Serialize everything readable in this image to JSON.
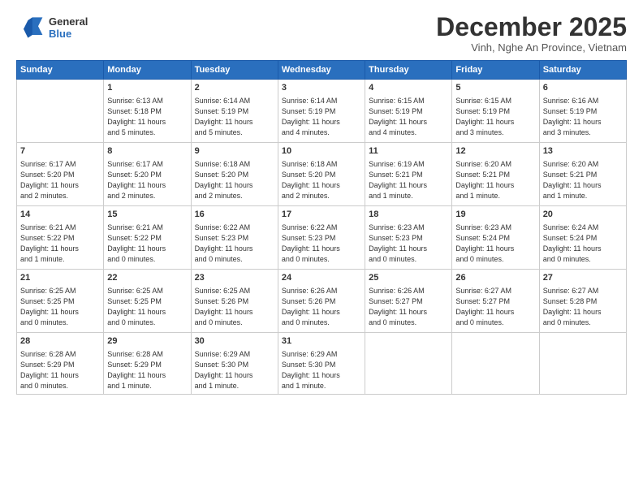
{
  "header": {
    "logo_line1": "General",
    "logo_line2": "Blue",
    "month_title": "December 2025",
    "location": "Vinh, Nghe An Province, Vietnam"
  },
  "days_of_week": [
    "Sunday",
    "Monday",
    "Tuesday",
    "Wednesday",
    "Thursday",
    "Friday",
    "Saturday"
  ],
  "weeks": [
    [
      {
        "date": "",
        "info": ""
      },
      {
        "date": "1",
        "info": "Sunrise: 6:13 AM\nSunset: 5:18 PM\nDaylight: 11 hours\nand 5 minutes."
      },
      {
        "date": "2",
        "info": "Sunrise: 6:14 AM\nSunset: 5:19 PM\nDaylight: 11 hours\nand 5 minutes."
      },
      {
        "date": "3",
        "info": "Sunrise: 6:14 AM\nSunset: 5:19 PM\nDaylight: 11 hours\nand 4 minutes."
      },
      {
        "date": "4",
        "info": "Sunrise: 6:15 AM\nSunset: 5:19 PM\nDaylight: 11 hours\nand 4 minutes."
      },
      {
        "date": "5",
        "info": "Sunrise: 6:15 AM\nSunset: 5:19 PM\nDaylight: 11 hours\nand 3 minutes."
      },
      {
        "date": "6",
        "info": "Sunrise: 6:16 AM\nSunset: 5:19 PM\nDaylight: 11 hours\nand 3 minutes."
      }
    ],
    [
      {
        "date": "7",
        "info": "Sunrise: 6:17 AM\nSunset: 5:20 PM\nDaylight: 11 hours\nand 2 minutes."
      },
      {
        "date": "8",
        "info": "Sunrise: 6:17 AM\nSunset: 5:20 PM\nDaylight: 11 hours\nand 2 minutes."
      },
      {
        "date": "9",
        "info": "Sunrise: 6:18 AM\nSunset: 5:20 PM\nDaylight: 11 hours\nand 2 minutes."
      },
      {
        "date": "10",
        "info": "Sunrise: 6:18 AM\nSunset: 5:20 PM\nDaylight: 11 hours\nand 2 minutes."
      },
      {
        "date": "11",
        "info": "Sunrise: 6:19 AM\nSunset: 5:21 PM\nDaylight: 11 hours\nand 1 minute."
      },
      {
        "date": "12",
        "info": "Sunrise: 6:20 AM\nSunset: 5:21 PM\nDaylight: 11 hours\nand 1 minute."
      },
      {
        "date": "13",
        "info": "Sunrise: 6:20 AM\nSunset: 5:21 PM\nDaylight: 11 hours\nand 1 minute."
      }
    ],
    [
      {
        "date": "14",
        "info": "Sunrise: 6:21 AM\nSunset: 5:22 PM\nDaylight: 11 hours\nand 1 minute."
      },
      {
        "date": "15",
        "info": "Sunrise: 6:21 AM\nSunset: 5:22 PM\nDaylight: 11 hours\nand 0 minutes."
      },
      {
        "date": "16",
        "info": "Sunrise: 6:22 AM\nSunset: 5:23 PM\nDaylight: 11 hours\nand 0 minutes."
      },
      {
        "date": "17",
        "info": "Sunrise: 6:22 AM\nSunset: 5:23 PM\nDaylight: 11 hours\nand 0 minutes."
      },
      {
        "date": "18",
        "info": "Sunrise: 6:23 AM\nSunset: 5:23 PM\nDaylight: 11 hours\nand 0 minutes."
      },
      {
        "date": "19",
        "info": "Sunrise: 6:23 AM\nSunset: 5:24 PM\nDaylight: 11 hours\nand 0 minutes."
      },
      {
        "date": "20",
        "info": "Sunrise: 6:24 AM\nSunset: 5:24 PM\nDaylight: 11 hours\nand 0 minutes."
      }
    ],
    [
      {
        "date": "21",
        "info": "Sunrise: 6:25 AM\nSunset: 5:25 PM\nDaylight: 11 hours\nand 0 minutes."
      },
      {
        "date": "22",
        "info": "Sunrise: 6:25 AM\nSunset: 5:25 PM\nDaylight: 11 hours\nand 0 minutes."
      },
      {
        "date": "23",
        "info": "Sunrise: 6:25 AM\nSunset: 5:26 PM\nDaylight: 11 hours\nand 0 minutes."
      },
      {
        "date": "24",
        "info": "Sunrise: 6:26 AM\nSunset: 5:26 PM\nDaylight: 11 hours\nand 0 minutes."
      },
      {
        "date": "25",
        "info": "Sunrise: 6:26 AM\nSunset: 5:27 PM\nDaylight: 11 hours\nand 0 minutes."
      },
      {
        "date": "26",
        "info": "Sunrise: 6:27 AM\nSunset: 5:27 PM\nDaylight: 11 hours\nand 0 minutes."
      },
      {
        "date": "27",
        "info": "Sunrise: 6:27 AM\nSunset: 5:28 PM\nDaylight: 11 hours\nand 0 minutes."
      }
    ],
    [
      {
        "date": "28",
        "info": "Sunrise: 6:28 AM\nSunset: 5:29 PM\nDaylight: 11 hours\nand 0 minutes."
      },
      {
        "date": "29",
        "info": "Sunrise: 6:28 AM\nSunset: 5:29 PM\nDaylight: 11 hours\nand 1 minute."
      },
      {
        "date": "30",
        "info": "Sunrise: 6:29 AM\nSunset: 5:30 PM\nDaylight: 11 hours\nand 1 minute."
      },
      {
        "date": "31",
        "info": "Sunrise: 6:29 AM\nSunset: 5:30 PM\nDaylight: 11 hours\nand 1 minute."
      },
      {
        "date": "",
        "info": ""
      },
      {
        "date": "",
        "info": ""
      },
      {
        "date": "",
        "info": ""
      }
    ]
  ]
}
